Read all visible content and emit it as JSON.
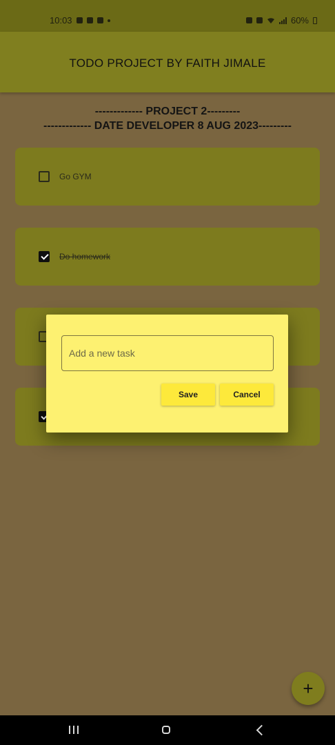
{
  "status_bar": {
    "time": "10:03",
    "battery": "60%",
    "icons": [
      "alarm-icon",
      "image-icon",
      "youtube-icon",
      "dot-icon",
      "alarm-icon",
      "mute-icon",
      "wifi-icon",
      "signal-icon",
      "battery-icon"
    ]
  },
  "app_bar": {
    "title": "TODO PROJECT BY FAITH JIMALE"
  },
  "header": {
    "line1": "------------- PROJECT 2---------",
    "line2": "------------- DATE DEVELOPER 8 AUG 2023---------"
  },
  "tasks": [
    {
      "label": "Go GYM",
      "done": false
    },
    {
      "label": "Do homework",
      "done": true
    },
    {
      "label": "",
      "done": false
    },
    {
      "label": "",
      "done": true
    }
  ],
  "dialog": {
    "placeholder": "Add a new task",
    "save_label": "Save",
    "cancel_label": "Cancel"
  },
  "fab": {
    "label": "+"
  },
  "colors": {
    "background": "#7a6540",
    "app_bar": "#807f1f",
    "card": "#7d7b1e",
    "dialog": "#fdf171",
    "button": "#fde93b"
  }
}
